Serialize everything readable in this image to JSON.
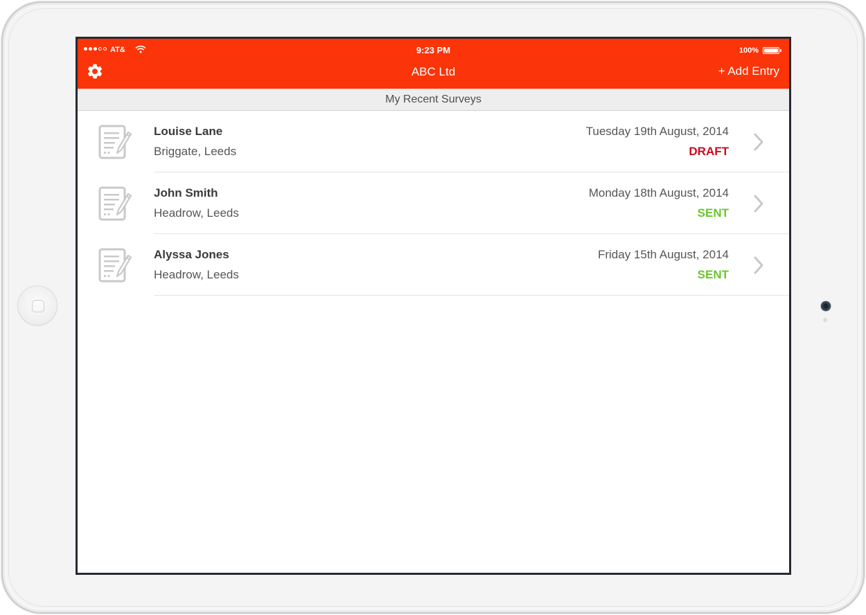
{
  "status_bar": {
    "carrier": "AT&",
    "time": "9:23 PM",
    "battery": "100%"
  },
  "nav": {
    "title": "ABC Ltd",
    "add_entry": "+ Add Entry",
    "settings_icon": "gear-icon"
  },
  "section": {
    "title": "My Recent Surveys"
  },
  "surveys": [
    {
      "name": "Louise Lane",
      "location": "Briggate, Leeds",
      "date": "Tuesday 19th August, 2014",
      "status": "DRAFT",
      "status_color": "#cc0a1d"
    },
    {
      "name": "John Smith",
      "location": "Headrow, Leeds",
      "date": "Monday 18th August, 2014",
      "status": "SENT",
      "status_color": "#6ac62a"
    },
    {
      "name": "Alyssa Jones",
      "location": "Headrow, Leeds",
      "date": "Friday 15th August, 2014",
      "status": "SENT",
      "status_color": "#6ac62a"
    }
  ],
  "colors": {
    "accent": "#fb3409",
    "draft": "#cc0a1d",
    "sent": "#6ac62a"
  }
}
